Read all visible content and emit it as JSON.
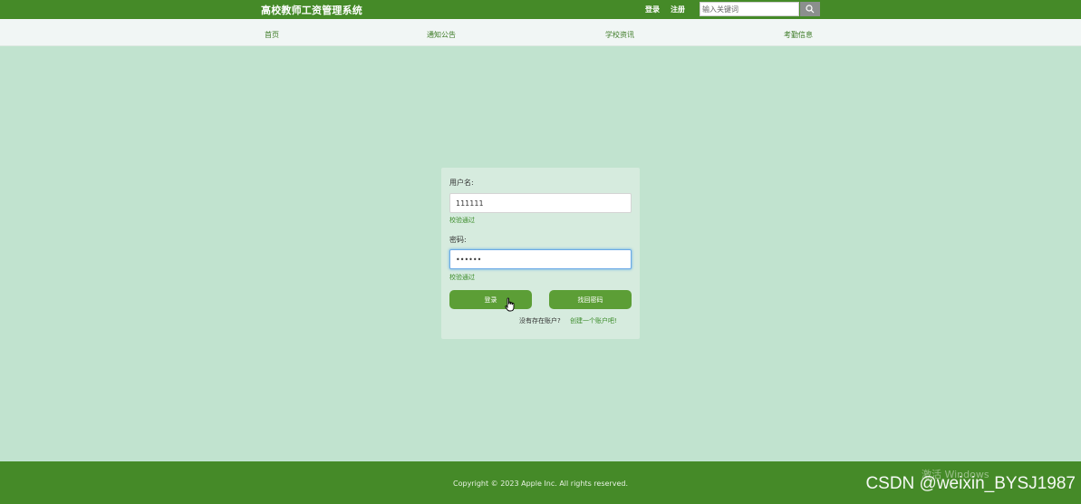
{
  "header": {
    "site_title": "高校教师工资管理系统",
    "login_link": "登录",
    "register_link": "注册",
    "search_placeholder": "输入关键词"
  },
  "nav": {
    "items": [
      {
        "label": "首页"
      },
      {
        "label": "通知公告"
      },
      {
        "label": "学校资讯"
      },
      {
        "label": "考勤信息"
      }
    ]
  },
  "login_form": {
    "username_label": "用户名:",
    "username_value": "111111",
    "username_valid": "校验通过",
    "password_label": "密码:",
    "password_value": "111111",
    "password_valid": "校验通过",
    "login_button": "登录",
    "forgot_button": "找回密码",
    "no_account_text": "没有存在账户?",
    "create_account_link": "创建一个账户吧!"
  },
  "footer": {
    "copyright": "Copyright © 2023 Apple Inc. All rights reserved.",
    "activate_windows": "激活 Windows",
    "watermark": "CSDN @weixin_BYSJ1987"
  },
  "colors": {
    "brand_green": "#458a28",
    "button_green": "#5c9e36",
    "page_background": "#c1e3cf"
  }
}
